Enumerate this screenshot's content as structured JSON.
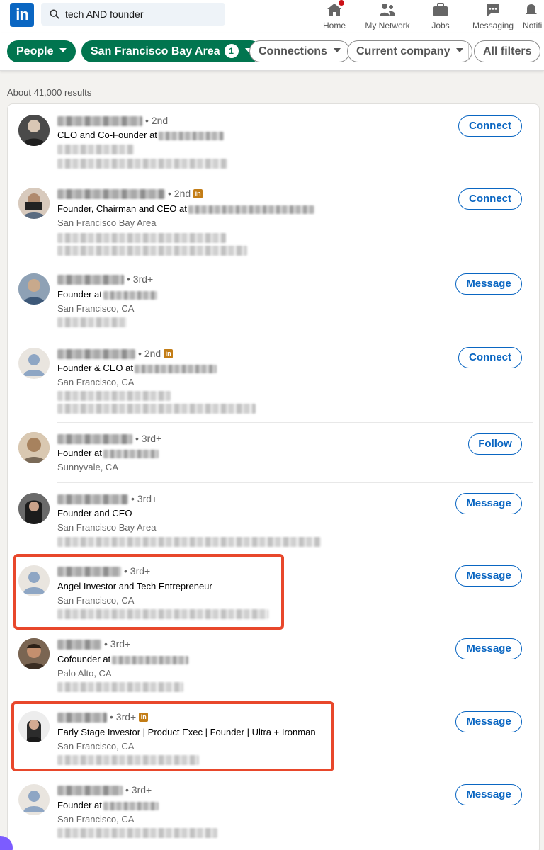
{
  "search": {
    "query": "tech AND founder"
  },
  "nav": {
    "home": "Home",
    "network": "My Network",
    "jobs": "Jobs",
    "messaging": "Messaging",
    "notifications": "Notifi"
  },
  "filters": {
    "people": "People",
    "location": "San Francisco Bay Area",
    "location_count": "1",
    "connections": "Connections",
    "company": "Current company",
    "all": "All filters"
  },
  "results_count": "About 41,000 results",
  "colors": {
    "brand": "#0a66c2",
    "filter_green": "#01754f",
    "highlight": "#e8472b",
    "premium": "#c37d16"
  },
  "results": [
    {
      "degree": "• 2nd",
      "premium": false,
      "headline": "CEO and Co-Founder at",
      "location": "",
      "action": "Connect"
    },
    {
      "degree": "• 2nd",
      "premium": true,
      "headline": "Founder, Chairman and CEO at",
      "location": "San Francisco Bay Area",
      "action": "Connect"
    },
    {
      "degree": "• 3rd+",
      "premium": false,
      "headline": "Founder at",
      "location": "San Francisco, CA",
      "action": "Message"
    },
    {
      "degree": "• 2nd",
      "premium": true,
      "headline": "Founder & CEO at",
      "location": "San Francisco, CA",
      "action": "Connect"
    },
    {
      "degree": "• 3rd+",
      "premium": false,
      "headline": "Founder at",
      "location": "Sunnyvale, CA",
      "action": "Follow"
    },
    {
      "degree": "• 3rd+",
      "premium": false,
      "headline": "Founder and CEO",
      "location": "San Francisco Bay Area",
      "action": "Message"
    },
    {
      "degree": "• 3rd+",
      "premium": false,
      "headline": "Angel Investor and Tech Entrepreneur",
      "location": "San Francisco, CA",
      "action": "Message"
    },
    {
      "degree": "• 3rd+",
      "premium": false,
      "headline": "Cofounder at",
      "location": "Palo Alto, CA",
      "action": "Message"
    },
    {
      "degree": "• 3rd+",
      "premium": true,
      "headline": "Early Stage Investor | Product Exec | Founder | Ultra + Ironman",
      "location": "San Francisco, CA",
      "action": "Message"
    },
    {
      "degree": "• 3rd+",
      "premium": false,
      "headline": "Founder at",
      "location": "San Francisco, CA",
      "action": "Message"
    }
  ]
}
